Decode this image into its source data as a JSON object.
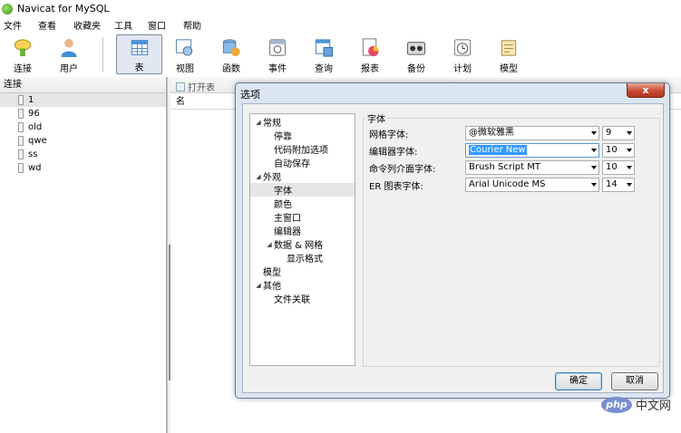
{
  "window": {
    "title": "Navicat for MySQL"
  },
  "menu": [
    "文件",
    "查看",
    "收藏夹",
    "工具",
    "窗口",
    "帮助"
  ],
  "toolbar": [
    {
      "label": "连接",
      "icon": "connection-icon",
      "active": false
    },
    {
      "label": "用户",
      "icon": "user-icon",
      "active": false
    },
    {
      "label": "表",
      "icon": "table-icon",
      "active": true
    },
    {
      "label": "视图",
      "icon": "view-icon",
      "active": false
    },
    {
      "label": "函数",
      "icon": "function-icon",
      "active": false
    },
    {
      "label": "事件",
      "icon": "event-icon",
      "active": false
    },
    {
      "label": "查询",
      "icon": "query-icon",
      "active": false
    },
    {
      "label": "报表",
      "icon": "report-icon",
      "active": false
    },
    {
      "label": "备份",
      "icon": "backup-icon",
      "active": false
    },
    {
      "label": "计划",
      "icon": "schedule-icon",
      "active": false
    },
    {
      "label": "模型",
      "icon": "model-icon",
      "active": false
    }
  ],
  "left_pane": {
    "header": "连接",
    "databases": [
      "1",
      "96",
      "old",
      "qwe",
      "ss",
      "wd"
    ]
  },
  "content": {
    "open_table_label": "打开表",
    "column_name": "名"
  },
  "dialog": {
    "title": "选项",
    "close_label": "x",
    "nav": [
      {
        "label": "常规",
        "level": 0,
        "arrow": "◢"
      },
      {
        "label": "停靠",
        "level": 1,
        "arrow": ""
      },
      {
        "label": "代码附加选项",
        "level": 1,
        "arrow": ""
      },
      {
        "label": "自动保存",
        "level": 1,
        "arrow": ""
      },
      {
        "label": "外观",
        "level": 0,
        "arrow": "◢"
      },
      {
        "label": "字体",
        "level": 1,
        "arrow": "",
        "selected": true
      },
      {
        "label": "颜色",
        "level": 1,
        "arrow": ""
      },
      {
        "label": "主窗口",
        "level": 1,
        "arrow": ""
      },
      {
        "label": "编辑器",
        "level": 1,
        "arrow": ""
      },
      {
        "label": "数据 & 网格",
        "level": 1,
        "arrow": "◢"
      },
      {
        "label": "显示格式",
        "level": 2,
        "arrow": ""
      },
      {
        "label": "模型",
        "level": 0,
        "arrow": ""
      },
      {
        "label": "其他",
        "level": 0,
        "arrow": "◢"
      },
      {
        "label": "文件关联",
        "level": 1,
        "arrow": ""
      }
    ],
    "group": "字体",
    "fonts": [
      {
        "label": "网格字体:",
        "font": "@微软雅黑",
        "size": "9",
        "highlight": false
      },
      {
        "label": "编辑器字体:",
        "font": "Courier New",
        "size": "10",
        "highlight": true
      },
      {
        "label": "命令列介面字体:",
        "font": "Brush Script MT",
        "size": "10",
        "highlight": false
      },
      {
        "label": "ER 图表字体:",
        "font": "Arial Unicode MS",
        "size": "14",
        "highlight": false
      }
    ],
    "ok_label": "确定",
    "cancel_label": "取消"
  },
  "watermark": {
    "badge": "php",
    "text": "中文网"
  }
}
